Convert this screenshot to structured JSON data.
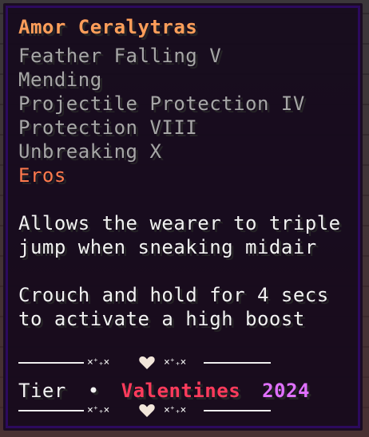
{
  "item": {
    "name": "Amor Ceralytras",
    "enchantments": [
      "Feather Falling V",
      "Mending",
      "Projectile Protection IV",
      "Protection VIII",
      "Unbreaking X"
    ],
    "set_name": "Eros",
    "ability_description": [
      "Allows the wearer to triple",
      "jump when sneaking midair"
    ],
    "usage_description": [
      "Crouch and hold for 4 secs",
      "to activate a high boost"
    ],
    "divider_sparkles_left": "×⁺₊×",
    "divider_sparkles_right": "×⁺₊×",
    "tier": {
      "label": "Tier",
      "separator": "•",
      "value_part1": "Valentines",
      "value_part2": "2024"
    }
  },
  "colors": {
    "title": "#ff9e5a",
    "enchantment": "#a7a7a7",
    "set_name": "#ff7a4d",
    "description": "#f2f2f2",
    "tier_value_part1": "#ff3b5c",
    "tier_value_part2": "#e070ff",
    "tooltip_background": "#160a1c",
    "tooltip_border": "#2c0a5e"
  },
  "icons": {
    "divider_center": "heart-icon"
  }
}
